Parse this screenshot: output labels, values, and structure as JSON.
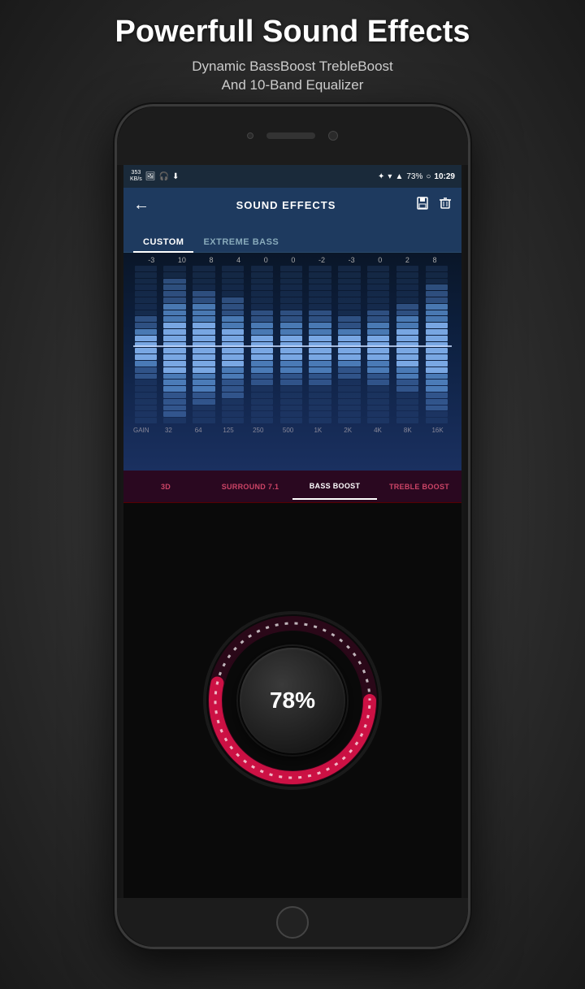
{
  "header": {
    "title": "Powerfull Sound Effects",
    "subtitle_line1": "Dynamic BassBoost TrebleBoost",
    "subtitle_line2": "And 10-Band Equalizer"
  },
  "status_bar": {
    "speed": "353\nKB/s",
    "battery": "73%",
    "time": "10:29"
  },
  "app_bar": {
    "title": "SOUND EFFECTS",
    "back_icon": "←",
    "save_icon": "💾",
    "delete_icon": "🗑"
  },
  "preset_tabs": [
    {
      "label": "CUSTOM",
      "active": true
    },
    {
      "label": "EXTREME BASS",
      "active": false
    }
  ],
  "equalizer": {
    "band_values": [
      "-3",
      "10",
      "8",
      "4",
      "0",
      "0",
      "-2",
      "-3",
      "0",
      "2",
      "8"
    ],
    "freq_labels": [
      "GAIN",
      "32",
      "64",
      "125",
      "250",
      "500",
      "1K",
      "2K",
      "4K",
      "8K",
      "16K"
    ],
    "band_heights": [
      40,
      85,
      75,
      60,
      50,
      50,
      45,
      40,
      50,
      55,
      80
    ]
  },
  "effect_tabs": [
    {
      "label": "3D",
      "active": false
    },
    {
      "label": "SURROUND 7.1",
      "active": false
    },
    {
      "label": "BASS BOOST",
      "active": true
    },
    {
      "label": "TREBLE BOOST",
      "active": false
    }
  ],
  "bass_boost": {
    "percentage": "78%"
  }
}
